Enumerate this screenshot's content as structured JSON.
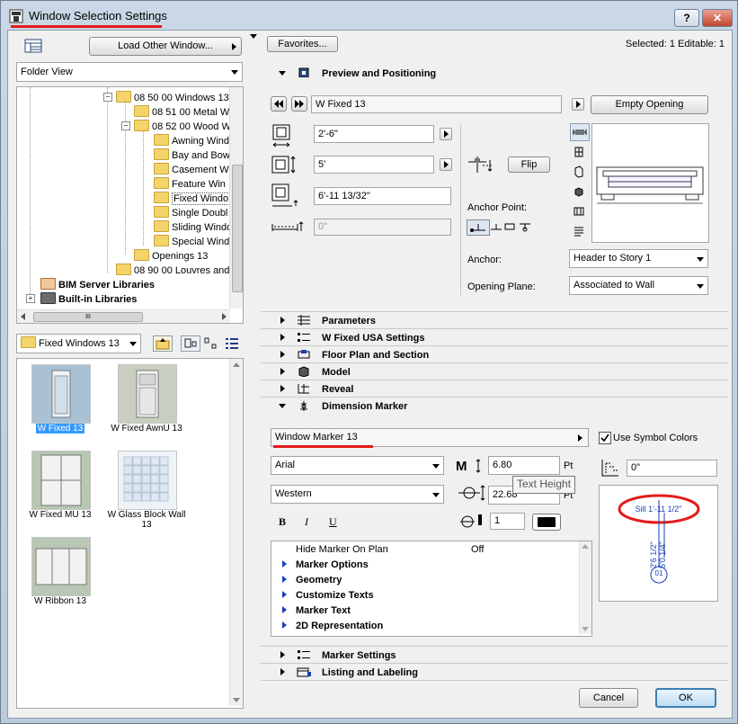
{
  "window": {
    "title": "Window Selection Settings",
    "help": "?",
    "close": "✕"
  },
  "left": {
    "load_other": "Load Other Window...",
    "folder_view": "Folder View",
    "tree": [
      {
        "label": "08 50 00 Windows 13"
      },
      {
        "label": "08 51 00 Metal W"
      },
      {
        "label": "08 52 00 Wood W"
      },
      {
        "label": "Awning Wind"
      },
      {
        "label": "Bay and Bow"
      },
      {
        "label": "Casement W"
      },
      {
        "label": "Feature Win"
      },
      {
        "label": "Fixed Windo"
      },
      {
        "label": "Single Doubl"
      },
      {
        "label": "Sliding Windo"
      },
      {
        "label": "Special Wind"
      },
      {
        "label": "Openings 13"
      },
      {
        "label": "08 90 00 Louvres and"
      },
      {
        "label": "BIM Server Libraries"
      },
      {
        "label": "Built-in Libraries"
      }
    ],
    "hscroll_grip": "III",
    "folder_select": "Fixed Windows 13",
    "items": [
      {
        "label": "W Fixed 13"
      },
      {
        "label": "W Fixed AwnU 13"
      },
      {
        "label": "W Fixed MU 13"
      },
      {
        "label": "W Glass Block Wall 13"
      },
      {
        "label": "W Ribbon 13"
      }
    ]
  },
  "top": {
    "favorites": "Favorites...",
    "status": "Selected: 1 Editable: 1"
  },
  "preview": {
    "header": "Preview and Positioning",
    "object_name": "W Fixed 13",
    "empty_opening": "Empty Opening",
    "width": "2'-6\"",
    "height": "5'",
    "sill": "6'-11 13/32\"",
    "reveal": "0\"",
    "flip": "Flip",
    "anchor_point": "Anchor Point:",
    "anchor_label": "Anchor:",
    "anchor_value": "Header to Story 1",
    "opening_plane_label": "Opening Plane:",
    "opening_plane_value": "Associated to Wall"
  },
  "sections": [
    {
      "label": "Parameters"
    },
    {
      "label": "W Fixed USA Settings"
    },
    {
      "label": "Floor Plan and Section"
    },
    {
      "label": "Model"
    },
    {
      "label": "Reveal"
    },
    {
      "label": "Dimension Marker"
    },
    {
      "label": "Marker Settings"
    },
    {
      "label": "Listing and Labeling"
    }
  ],
  "marker": {
    "name": "Window Marker 13",
    "use_symbol_colors": "Use Symbol Colors",
    "font": "Arial",
    "script": "Western",
    "text_height": "6.80",
    "text_height_unit": "Pt",
    "second_value": "22.68",
    "second_unit": "Pt",
    "tooltip": "Text Height",
    "bold": "B",
    "italic": "I",
    "underline": "U",
    "pen": "1",
    "offset": "0\"",
    "list": [
      {
        "label": "Hide Marker On Plan",
        "value": "Off"
      },
      {
        "label": "Marker Options",
        "value": ""
      },
      {
        "label": "Geometry",
        "value": ""
      },
      {
        "label": "Customize Texts",
        "value": ""
      },
      {
        "label": "Marker Text",
        "value": ""
      },
      {
        "label": "2D Representation",
        "value": ""
      }
    ],
    "preview_sill": "Sill 1'-11 1/2\"",
    "preview_dim1": "2'6 1/2\"",
    "preview_dim2": "5'0 1/4\"",
    "preview_id": "01"
  },
  "buttons": {
    "cancel": "Cancel",
    "ok": "OK"
  },
  "colors": {
    "accent": "#e31b1b",
    "selection": "#3399ff",
    "link_blue": "#1a3fb8"
  }
}
